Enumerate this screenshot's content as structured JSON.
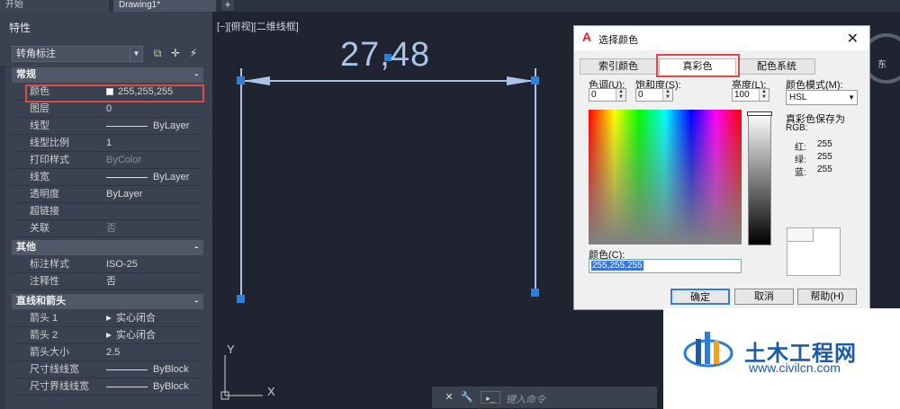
{
  "tabs": {
    "start": "开始",
    "drawing": "Drawing1*",
    "add": "+"
  },
  "palette": {
    "title": "特性",
    "selector": "转角标注",
    "sections": {
      "general": {
        "label": "常规",
        "toggle": "-"
      },
      "misc": {
        "label": "其他",
        "toggle": "-"
      },
      "lines_arrows": {
        "label": "直线和箭头",
        "toggle": "-"
      }
    },
    "general_rows": [
      {
        "label": "颜色",
        "value": "255,255,255"
      },
      {
        "label": "图层",
        "value": "0"
      },
      {
        "label": "线型",
        "value": "ByLayer"
      },
      {
        "label": "线型比例",
        "value": "1"
      },
      {
        "label": "打印样式",
        "value": "ByColor"
      },
      {
        "label": "线宽",
        "value": "ByLayer"
      },
      {
        "label": "透明度",
        "value": "ByLayer"
      },
      {
        "label": "超链接",
        "value": ""
      },
      {
        "label": "关联",
        "value": "否"
      }
    ],
    "misc_rows": [
      {
        "label": "标注样式",
        "value": "ISO-25"
      },
      {
        "label": "注释性",
        "value": "否"
      }
    ],
    "lines_rows": [
      {
        "label": "箭头 1",
        "value": "实心闭合"
      },
      {
        "label": "箭头 2",
        "value": "实心闭合"
      },
      {
        "label": "箭头大小",
        "value": "2.5"
      },
      {
        "label": "尺寸线线宽",
        "value": "ByBlock"
      },
      {
        "label": "尺寸界线线宽",
        "value": "ByBlock"
      }
    ]
  },
  "canvas": {
    "viewport_label": "[−][俯视][二维线框]",
    "dimension_text": "27,48",
    "ucs_y": "Y",
    "ucs_x": "X",
    "viewcube_label": "东"
  },
  "dialog": {
    "title": "选择颜色",
    "close": "✕",
    "tabs": [
      "索引颜色",
      "真彩色",
      "配色系统"
    ],
    "active_tab": "真彩色",
    "hue_label": "色调(U):",
    "hue_value": "0",
    "sat_label": "饱和度(S):",
    "sat_value": "0",
    "lum_label": "亮度(L):",
    "lum_value": "100",
    "mode_label": "颜色模式(M):",
    "mode_value": "HSL",
    "saved_as": "真彩色保存为",
    "rgb_label": "RGB:",
    "red_label": "红:",
    "red_value": "255",
    "green_label": "绿:",
    "green_value": "255",
    "blue_label": "蓝:",
    "blue_value": "255",
    "color_label": "颜色(C):",
    "color_value": "255,255,255",
    "ok": "确定",
    "cancel": "取消",
    "help": "帮助(H)"
  },
  "command": {
    "placeholder": "键入命令"
  },
  "watermark": {
    "name": "土木工程网",
    "url": "www.civilcn.com"
  },
  "colors": {
    "highlight": "#e04a4a",
    "dimension": "#a9c4e6",
    "canvas_bg": "#1f2430",
    "grip": "#2f7fd6"
  }
}
